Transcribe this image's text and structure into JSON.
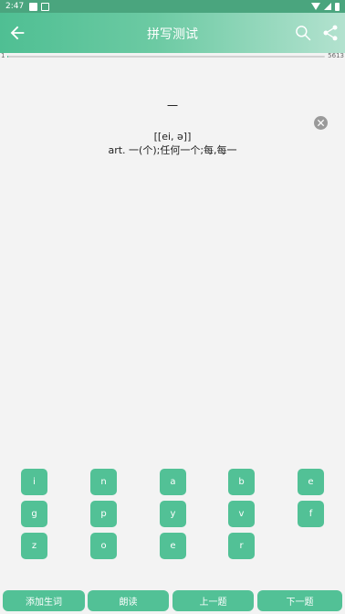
{
  "status_bar": {
    "time": "2:47"
  },
  "header": {
    "title": "拼写测试"
  },
  "progress": {
    "start_label": "1",
    "end_label": "5613",
    "current": 1,
    "total": 5613
  },
  "word": {
    "text": "一",
    "phonetic": "[[ei, ə]]",
    "meaning": "art. 一(个);任何一个;每,每一"
  },
  "keyboard": {
    "row1": [
      "i",
      "n",
      "a",
      "b",
      "e"
    ],
    "row2": [
      "g",
      "p",
      "y",
      "v",
      "f"
    ],
    "row3": [
      "z",
      "o",
      "e",
      "r"
    ]
  },
  "bottom": {
    "add_word": "添加生词",
    "read_aloud": "朗读",
    "prev": "上一题",
    "next": "下一题"
  },
  "colors": {
    "accent": "#52c196",
    "header_start": "#4fbf93",
    "header_end": "#b3e2cf"
  }
}
